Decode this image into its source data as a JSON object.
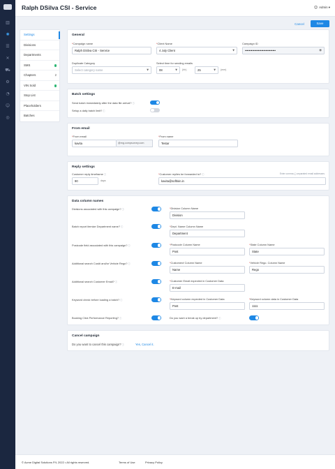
{
  "header": {
    "title": "Ralph DSilva CSI - Service",
    "user": "Admin"
  },
  "rail_icons": [
    "chart-icon",
    "campaign-icon",
    "list-icon",
    "tools-icon",
    "truck-icon",
    "settings-icon",
    "gauge-icon",
    "user-plus-icon",
    "target-icon"
  ],
  "actions": {
    "cancel": "Cancel",
    "save": "Save"
  },
  "subnav": [
    {
      "label": "Settings",
      "active": true
    },
    {
      "label": "Divisions"
    },
    {
      "label": "Departments"
    },
    {
      "label": "SMS",
      "status": "green"
    },
    {
      "label": "Chapters",
      "count": "2"
    },
    {
      "label": "VIN Sold",
      "status": "green"
    },
    {
      "label": "Stop List"
    },
    {
      "label": "Placeholders"
    },
    {
      "label": "Batches"
    }
  ],
  "general": {
    "heading": "General",
    "campaign_name_label": "Campaign name",
    "campaign_name": "Ralph DSilva CSI - Service",
    "client_name_label": "Client Name",
    "client_name": "4 July Client",
    "campaign_id_label": "Campaign ID",
    "campaign_id": "••••••••••••••••••••••••••••••",
    "duplicate_label": "Duplicate Category",
    "duplicate_placeholder": "Select category name",
    "time_label": "Select time for sending emails",
    "hour": "08",
    "hour_unit": "(hh)",
    "minute": "25",
    "minute_unit": "(mm)"
  },
  "batch": {
    "heading": "Batch settings",
    "send_label": "Send batch immediately after the data file arrival?",
    "daily_label": "Setup a daily batch limit?"
  },
  "from_email": {
    "heading": "From email",
    "email_label": "From email",
    "email_user": "kavita",
    "email_domain": "@mg.compsurvey.com",
    "name_label": "From name",
    "name": "Testar"
  },
  "reply": {
    "heading": "Reply settings",
    "timeframe_label": "Customer reply timeframe",
    "timeframe": "90",
    "timeframe_unit": "days",
    "forward_label": "Customer replies be forwarded to?",
    "forward_hint": "Enter comma (,) separated email addresses",
    "forward": "kavita@softloin.in"
  },
  "columns": {
    "heading": "Data column names",
    "q1": "Divisions associated with this campaign?",
    "q2": "Batch report itemize Department name?",
    "q3": "Postcode field associated with this campaign?",
    "q4": "Additional search Cust# and/or Vehicle Rego?",
    "q5": "Additional search Customer Email?",
    "q6": "Keyword check before loading a batch?",
    "q7": "Booking Click Performance Reporting?",
    "division_label": "Division Column Name",
    "division": "Division",
    "dept_label": "Dept. Name Column Name",
    "dept": "Department",
    "postcode_label": "Postcode Column Name",
    "postcode": "Post",
    "state_label": "State Column Name",
    "state": "State",
    "customer_label": "Customer# Column Name",
    "customer": "Name",
    "rego_label": "Vehicle Rego. Column Name",
    "rego": "Rego",
    "cust_email_label": "Customer Email expected in Customer Data",
    "cust_email": "E-mail",
    "kw_expected_label": "Keyword column expected in Customer Data",
    "kw_expected": "Post",
    "kw_data_label": "Keyword column data in Customer Data",
    "kw_data": "1111",
    "breakup_label": "Do you want a break up by department?"
  },
  "cancel_campaign": {
    "heading": "Cancel campaign",
    "question": "Do you want to cancel this campaign?",
    "link": "Yes, Cancel it."
  },
  "footer": {
    "copyright": "© Acme Digital Solutions P/L 2022 • All rights reserved.",
    "terms": "Terms of Use",
    "privacy": "Privacy Policy"
  },
  "colors": {
    "accent": "#1e88e5",
    "rail": "#1b2740",
    "status_green": "#2bb673",
    "required": "#e53935"
  }
}
